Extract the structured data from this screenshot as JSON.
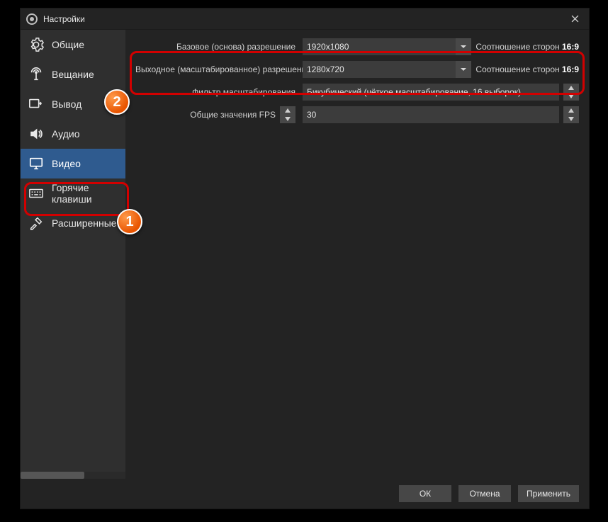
{
  "window": {
    "title": "Настройки"
  },
  "sidebar": {
    "items": [
      {
        "label": "Общие"
      },
      {
        "label": "Вещание"
      },
      {
        "label": "Вывод"
      },
      {
        "label": "Аудио"
      },
      {
        "label": "Видео"
      },
      {
        "label": "Горячие клавиши"
      },
      {
        "label": "Расширенные"
      }
    ]
  },
  "video": {
    "base_label": "Базовое (основа) разрешение",
    "base_value": "1920x1080",
    "base_aspect_label": "Соотношение сторон",
    "base_aspect_value": "16:9",
    "output_label": "Выходное (масштабированное) разрешение",
    "output_value": "1280x720",
    "output_aspect_label": "Соотношение сторон",
    "output_aspect_value": "16:9",
    "filter_label": "Фильтр масштабирования",
    "filter_value": "Бикубический (чёткое масштабирование, 16 выборок)",
    "fps_label": "Общие значения FPS",
    "fps_value": "30"
  },
  "footer": {
    "ok": "ОК",
    "cancel": "Отмена",
    "apply": "Применить"
  },
  "markers": {
    "m1": "1",
    "m2": "2"
  }
}
